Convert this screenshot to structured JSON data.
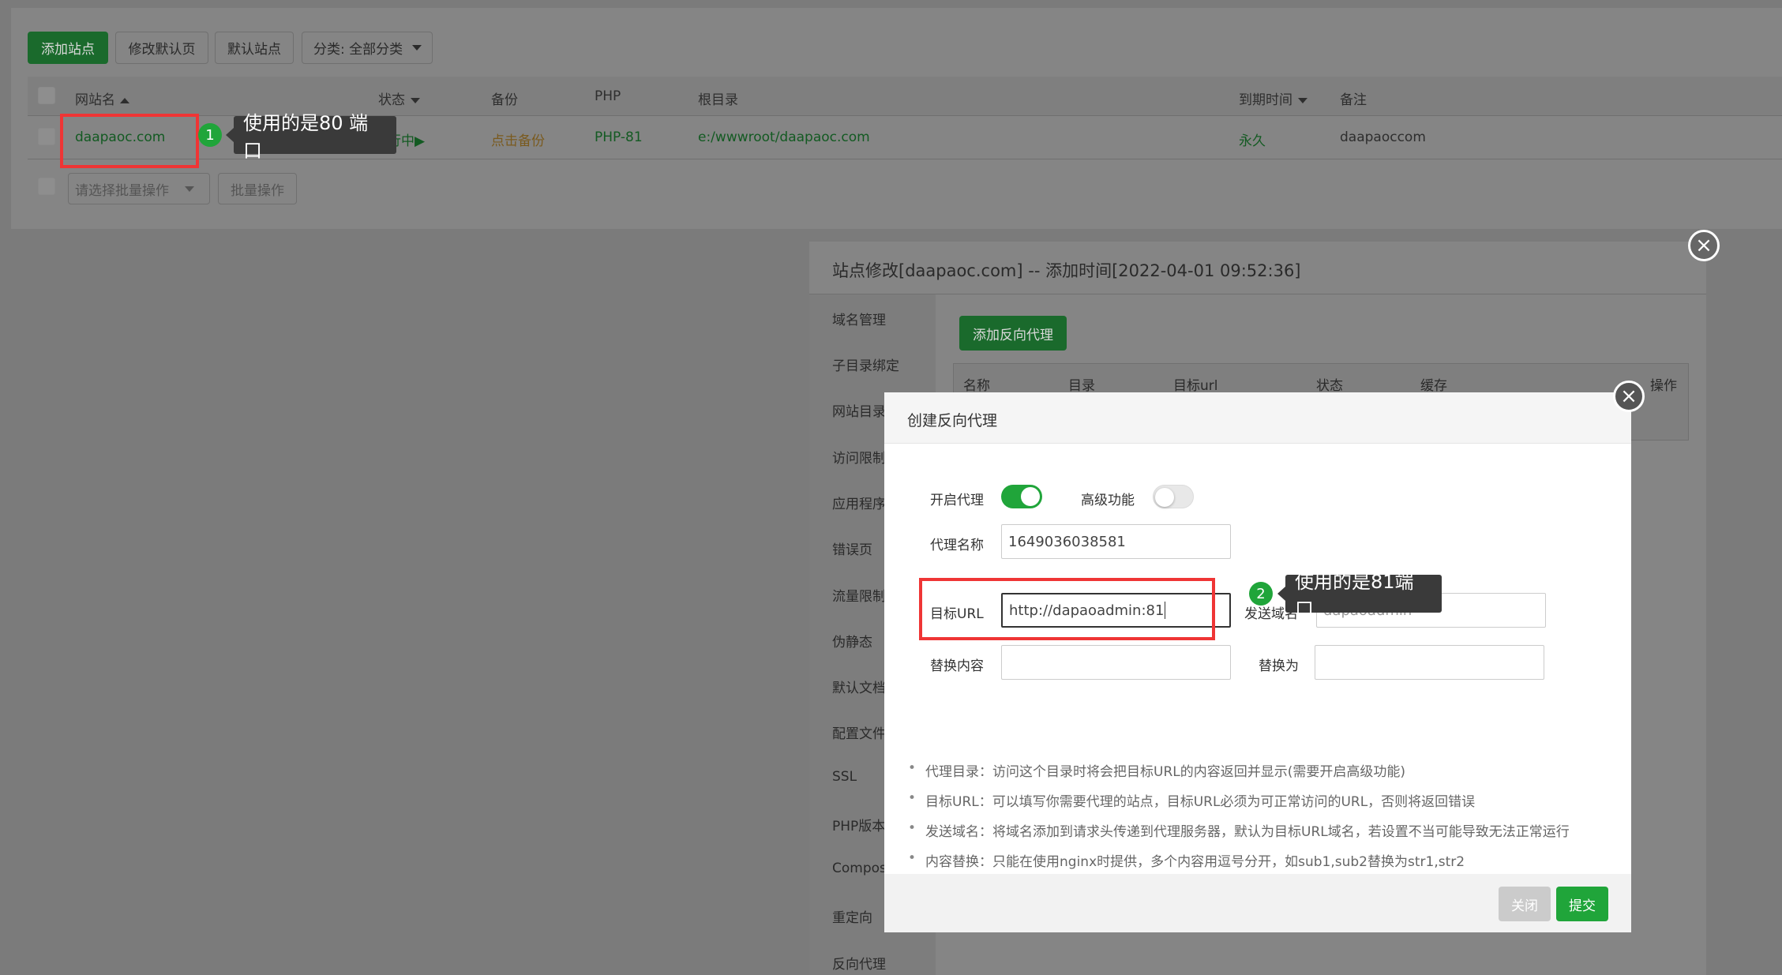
{
  "toolbar": {
    "add_site": "添加站点",
    "edit_default_page": "修改默认页",
    "default_site": "默认站点",
    "category_select": "分类: 全部分类"
  },
  "table": {
    "headers": {
      "site_name": "网站名",
      "status": "状态",
      "backup": "备份",
      "php": "PHP",
      "root": "根目录",
      "expire": "到期时间",
      "note": "备注"
    },
    "row": {
      "site_name": "daapaoc.com",
      "status": "运行中▶",
      "backup": "点击备份",
      "php": "PHP-81",
      "root": "e:/wwwroot/daapaoc.com",
      "expire": "永久",
      "note": "daapaoccom"
    },
    "batch_select": "请选择批量操作",
    "batch_button": "批量操作"
  },
  "annotations": {
    "one_num": "1",
    "one_text": "使用的是80 端口",
    "two_num": "2",
    "two_text": "使用的是81端口"
  },
  "site_dialog": {
    "title": "站点修改[daapaoc.com] -- 添加时间[2022-04-01 09:52:36]",
    "menu": [
      "域名管理",
      "子目录绑定",
      "网站目录",
      "访问限制",
      "应用程序",
      "错误页",
      "流量限制",
      "伪静态",
      "默认文档",
      "配置文件",
      "SSL",
      "PHP版本",
      "Composer",
      "重定向",
      "反向代理"
    ],
    "add_proxy_button": "添加反向代理",
    "proxy_headers": [
      "名称",
      "目录",
      "目标url",
      "状态",
      "缓存",
      "操作"
    ]
  },
  "proxy_dialog": {
    "title": "创建反向代理",
    "enable_label": "开启代理",
    "advanced_label": "高级功能",
    "name_label": "代理名称",
    "name_value": "1649036038581",
    "target_label": "目标URL",
    "target_value": "http://dapaoadmin:81",
    "send_domain_label": "发送域名",
    "send_domain_value": "dapaoadmin",
    "replace_label": "替换内容",
    "replace_value": "",
    "replace_with_label": "替换为",
    "replace_with_value": "",
    "notes": [
      "代理目录：访问这个目录时将会把目标URL的内容返回并显示(需要开启高级功能)",
      "目标URL：可以填写你需要代理的站点，目标URL必须为可正常访问的URL，否则将返回错误",
      "发送域名：将域名添加到请求头传递到代理服务器，默认为目标URL域名，若设置不当可能导致无法正常运行",
      "内容替换：只能在使用nginx时提供，多个内容用逗号分开，如sub1,sub2替换为str1,str2"
    ],
    "close_button": "关闭",
    "submit_button": "提交",
    "enable_on": true,
    "advanced_on": false
  },
  "colors": {
    "brand_green": "#20a53a",
    "alert_red": "#ef3535",
    "overlay_gray": "#7b7b7b"
  }
}
